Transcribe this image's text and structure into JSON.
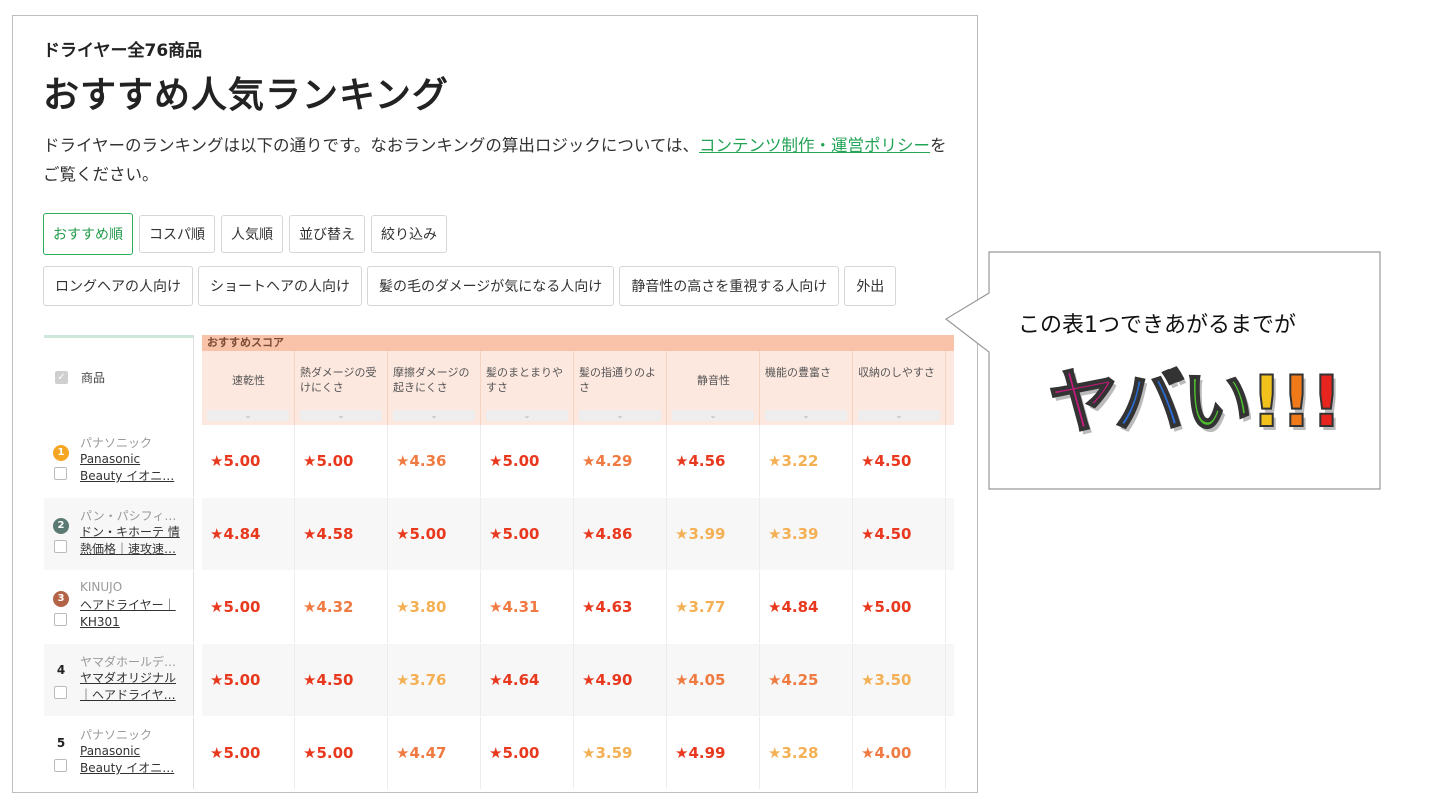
{
  "header": {
    "subtitle": "ドライヤー全76商品",
    "title": "おすすめ人気ランキング",
    "desc_main": "ドライヤーのランキングは以下の通りです。なおランキングの算出ロジックについては、",
    "desc_link": "コンテンツ制作・運営ポリシー",
    "desc_tail": "をご覧ください。"
  },
  "sort_tabs": [
    "おすすめ順",
    "コスパ順",
    "人気順",
    "並び替え",
    "絞り込み"
  ],
  "filter_chips": [
    "ロングヘアの人向け",
    "ショートヘアの人向け",
    "髪の毛のダメージが気になる人向け",
    "静音性の高さを重視する人向け",
    "外出"
  ],
  "table": {
    "product_header": "商品",
    "score_band": "おすすめスコア",
    "columns": [
      "速乾性",
      "熱ダメージの受けにくさ",
      "摩擦ダメージの起きにくさ",
      "髪のまとまりやすさ",
      "髪の指通りのよさ",
      "静音性",
      "機能の豊富さ",
      "収納のしやすさ"
    ],
    "rows": [
      {
        "rank": "1",
        "brand": "パナソニック",
        "name": [
          "Panasonic",
          "Beauty イオニ…"
        ],
        "scores": [
          "★5.00",
          "★5.00",
          "★4.36",
          "★5.00",
          "★4.29",
          "★4.56",
          "★3.22",
          "★4.50"
        ],
        "levels": [
          "hi",
          "hi",
          "mid",
          "hi",
          "mid",
          "hi",
          "lo",
          "hi"
        ]
      },
      {
        "rank": "2",
        "brand": "パン・パシフィ…",
        "name": [
          "ドン・キホーテ 情",
          "熱価格｜速攻速…"
        ],
        "scores": [
          "★4.84",
          "★4.58",
          "★5.00",
          "★5.00",
          "★4.86",
          "★3.99",
          "★3.39",
          "★4.50"
        ],
        "levels": [
          "hi",
          "hi",
          "hi",
          "hi",
          "hi",
          "lo",
          "lo",
          "hi"
        ]
      },
      {
        "rank": "3",
        "brand": "KINUJO",
        "name": [
          "ヘアドライヤー｜",
          "KH301"
        ],
        "scores": [
          "★5.00",
          "★4.32",
          "★3.80",
          "★4.31",
          "★4.63",
          "★3.77",
          "★4.84",
          "★5.00"
        ],
        "levels": [
          "hi",
          "mid",
          "lo",
          "mid",
          "hi",
          "lo",
          "hi",
          "hi"
        ]
      },
      {
        "rank": "4",
        "brand": "ヤマダホールデ…",
        "name": [
          "ヤマダオリジナル",
          "｜ヘアドライヤ…"
        ],
        "scores": [
          "★5.00",
          "★4.50",
          "★3.76",
          "★4.64",
          "★4.90",
          "★4.05",
          "★4.25",
          "★3.50"
        ],
        "levels": [
          "hi",
          "hi",
          "lo",
          "hi",
          "hi",
          "mid",
          "mid",
          "lo"
        ]
      },
      {
        "rank": "5",
        "brand": "パナソニック",
        "name": [
          "Panasonic",
          "Beauty イオニ…"
        ],
        "scores": [
          "★5.00",
          "★5.00",
          "★4.47",
          "★5.00",
          "★3.59",
          "★4.99",
          "★3.28",
          "★4.00"
        ],
        "levels": [
          "hi",
          "hi",
          "mid",
          "hi",
          "lo",
          "hi",
          "lo",
          "mid"
        ]
      }
    ]
  },
  "callout": {
    "text": "この表1つできあがるまでが",
    "big": [
      "ヤ",
      "バ",
      "い",
      "!",
      "!",
      "!"
    ],
    "big_colors": [
      "#c7197e",
      "#2a6bd1",
      "#4cc12c",
      "#f0c21b",
      "#f07a1a",
      "#e8241f"
    ]
  },
  "colors": {
    "accent_green": "#23a455",
    "score_high": "#e8391f",
    "score_mid": "#ef7b42",
    "score_low": "#f4b055",
    "score_band": "#f9c3a9"
  }
}
